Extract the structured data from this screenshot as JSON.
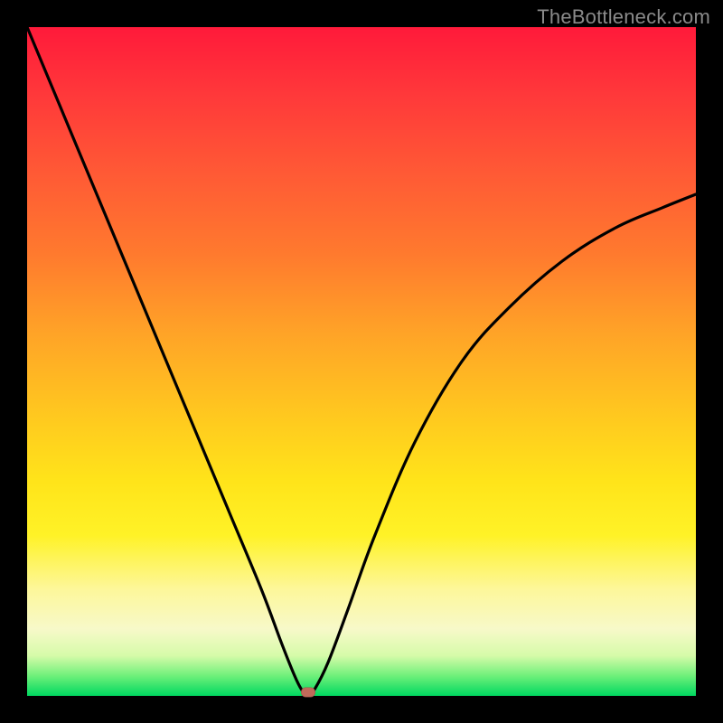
{
  "watermark": "TheBottleneck.com",
  "colors": {
    "background_frame": "#000000",
    "curve": "#000000",
    "marker": "#c06a5a",
    "gradient_top": "#ff1a3a",
    "gradient_bottom": "#00d860"
  },
  "chart_data": {
    "type": "line",
    "title": "",
    "xlabel": "",
    "ylabel": "",
    "xlim": [
      0,
      100
    ],
    "ylim": [
      0,
      100
    ],
    "grid": false,
    "legend": false,
    "annotations": [],
    "series": [
      {
        "name": "bottleneck-curve",
        "x": [
          0,
          5,
          10,
          15,
          20,
          25,
          30,
          35,
          38,
          40,
          41,
          42,
          43,
          45,
          48,
          52,
          58,
          65,
          72,
          80,
          88,
          95,
          100
        ],
        "y": [
          100,
          88,
          76,
          64,
          52,
          40,
          28,
          16,
          8,
          3,
          1,
          0,
          1,
          5,
          13,
          24,
          38,
          50,
          58,
          65,
          70,
          73,
          75
        ]
      }
    ],
    "marker": {
      "x": 42,
      "y": 0.5
    }
  }
}
